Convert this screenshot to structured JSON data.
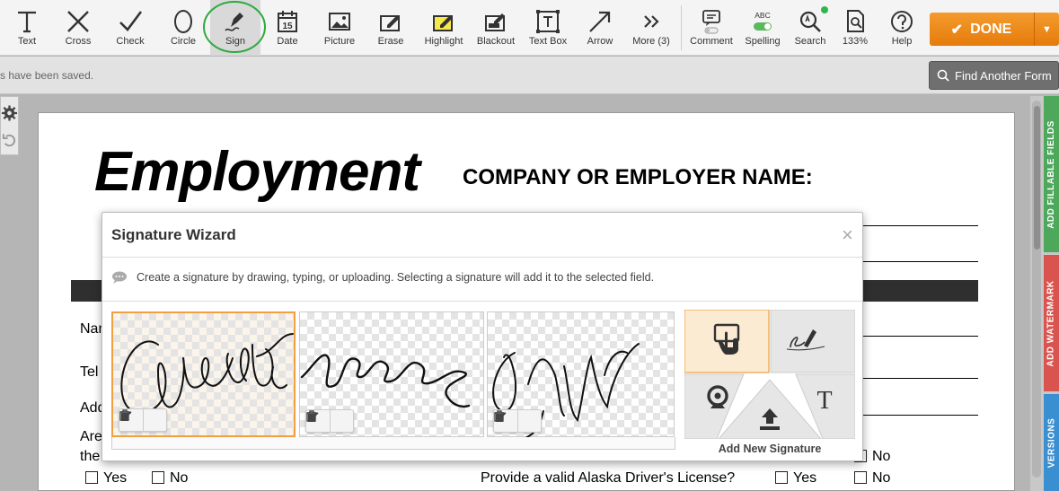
{
  "toolbar": {
    "tools": [
      {
        "label": "Text",
        "icon": "text-icon"
      },
      {
        "label": "Cross",
        "icon": "cross-icon"
      },
      {
        "label": "Check",
        "icon": "check-icon"
      },
      {
        "label": "Circle",
        "icon": "circle-icon"
      },
      {
        "label": "Sign",
        "icon": "sign-pen-icon"
      },
      {
        "label": "Date",
        "icon": "calendar-icon",
        "icon_text": "15"
      },
      {
        "label": "Picture",
        "icon": "picture-icon"
      },
      {
        "label": "Erase",
        "icon": "eraser-icon"
      },
      {
        "label": "Highlight",
        "icon": "highlight-icon"
      },
      {
        "label": "Blackout",
        "icon": "blackout-icon"
      },
      {
        "label": "Text Box",
        "icon": "textbox-icon"
      },
      {
        "label": "Arrow",
        "icon": "arrow-icon"
      },
      {
        "label": "More (3)",
        "icon": "more-icon"
      },
      {
        "label": "Comment",
        "icon": "comment-icon"
      },
      {
        "label": "Spelling",
        "icon": "spelling-icon",
        "icon_text": "ABC"
      },
      {
        "label": "Search",
        "icon": "search-icon"
      },
      {
        "label": "133%",
        "icon": "zoom-icon"
      },
      {
        "label": "Help",
        "icon": "help-icon"
      }
    ],
    "active_tool": "Sign",
    "done_label": "DONE"
  },
  "status": {
    "saved_text": "s have been saved.",
    "find_form_label": "Find Another Form"
  },
  "side_tabs": {
    "add_fillable_fields": "ADD FILLABLE FIELDS",
    "add_watermark": "ADD WATERMARK",
    "versions": "VERSIONS"
  },
  "document": {
    "title": "Employment",
    "company_label": "COMPANY OR EMPLOYER NAME:",
    "field_nam": "Nam",
    "field_tel": "Tel",
    "field_add": "Add",
    "field_are": "Are",
    "field_the": "the",
    "yes_label": "Yes",
    "no_label": "No",
    "license_question": "Provide a valid Alaska Driver's License?",
    "license_yes": "Yes",
    "license_no": "No",
    "no_right": "No"
  },
  "wizard": {
    "title": "Signature Wizard",
    "close_glyph": "×",
    "info_text": "Create a signature by drawing, typing, or uploading. Selecting a signature will add it to the selected field.",
    "signatures_count": 3,
    "selected_signature": 1,
    "add_new_label": "Add New Signature",
    "add_options": [
      "draw-on-device",
      "draw-with-pen",
      "webcam",
      "upload",
      "type"
    ]
  },
  "colors": {
    "done_orange": "#f08a1c",
    "selected_sig_border": "#f0a040",
    "tab_green": "#4da85c",
    "tab_red": "#d9534f",
    "tab_blue": "#3a8fd0",
    "annotation_circle": "#2faa3f",
    "spelling_dot": "#2db84b"
  }
}
